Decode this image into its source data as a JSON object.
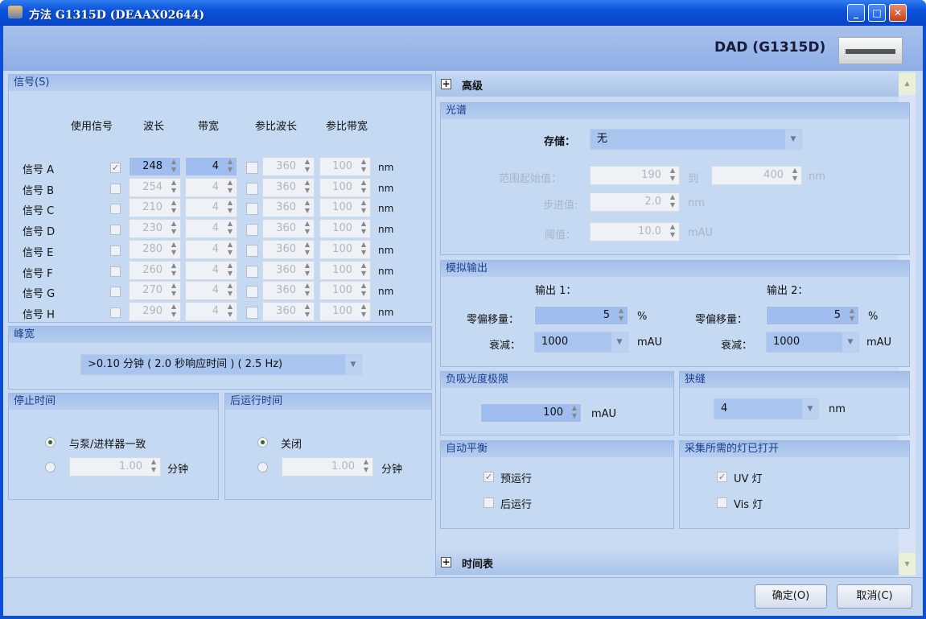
{
  "window": {
    "title": "方法 G1315D (DEAAX02644)",
    "minimize": "_",
    "maximize": "□",
    "close": "✕"
  },
  "header": {
    "device": "DAD (G1315D)"
  },
  "signals": {
    "title": "信号(S)",
    "columns": [
      "使用信号",
      "波长",
      "带宽",
      "参比波长",
      "参比带宽"
    ],
    "unit": "nm",
    "rows": [
      {
        "label": "信号 A",
        "use": true,
        "wl": "248",
        "bw": "4",
        "ref": false,
        "ref_wl": "360",
        "ref_bw": "100"
      },
      {
        "label": "信号 B",
        "use": false,
        "wl": "254",
        "bw": "4",
        "ref": false,
        "ref_wl": "360",
        "ref_bw": "100"
      },
      {
        "label": "信号 C",
        "use": false,
        "wl": "210",
        "bw": "4",
        "ref": false,
        "ref_wl": "360",
        "ref_bw": "100"
      },
      {
        "label": "信号 D",
        "use": false,
        "wl": "230",
        "bw": "4",
        "ref": false,
        "ref_wl": "360",
        "ref_bw": "100"
      },
      {
        "label": "信号 E",
        "use": false,
        "wl": "280",
        "bw": "4",
        "ref": false,
        "ref_wl": "360",
        "ref_bw": "100"
      },
      {
        "label": "信号 F",
        "use": false,
        "wl": "260",
        "bw": "4",
        "ref": false,
        "ref_wl": "360",
        "ref_bw": "100"
      },
      {
        "label": "信号 G",
        "use": false,
        "wl": "270",
        "bw": "4",
        "ref": false,
        "ref_wl": "360",
        "ref_bw": "100"
      },
      {
        "label": "信号 H",
        "use": false,
        "wl": "290",
        "bw": "4",
        "ref": false,
        "ref_wl": "360",
        "ref_bw": "100"
      }
    ]
  },
  "peakwidth": {
    "title": "峰宽",
    "value": ">0.10 分钟 ( 2.0 秒响应时间 ) ( 2.5 Hz)"
  },
  "stoptime": {
    "title": "停止时间",
    "opt1": "与泵/进样器一致",
    "value": "1.00",
    "unit": "分钟"
  },
  "posttime": {
    "title": "后运行时间",
    "opt1": "关闭",
    "value": "1.00",
    "unit": "分钟"
  },
  "advanced": {
    "title": "高级"
  },
  "spectrum": {
    "title": "光谱",
    "store_label": "存储：",
    "store_value": "无",
    "range_label": "范围起始值：",
    "range_from": "190",
    "to": "到",
    "range_to": "400",
    "nm": "nm",
    "step_label": "步进值:",
    "step": "2.0",
    "threshold_label": "阈值：",
    "threshold": "10.0",
    "mau": "mAU"
  },
  "analog": {
    "title": "模拟输出",
    "out1": "输出 1：",
    "out2": "输出 2：",
    "zero_label": "零偏移量：",
    "zero1": "5",
    "zero2": "5",
    "pct": "%",
    "atten_label": "衰减：",
    "atten1": "1000",
    "atten2": "1000",
    "mau": "mAU"
  },
  "negabs": {
    "title": "负吸光度极限",
    "value": "100",
    "unit": "mAU"
  },
  "slit": {
    "title": "狭缝",
    "value": "4",
    "unit": "nm"
  },
  "autobal": {
    "title": "自动平衡",
    "pre": "预运行",
    "pre_checked": true,
    "post": "后运行",
    "post_checked": false
  },
  "lamps": {
    "title": "采集所需的灯已打开",
    "uv": "UV 灯",
    "uv_checked": true,
    "vis": "Vis 灯",
    "vis_checked": false
  },
  "timetable": {
    "title": "时间表"
  },
  "buttons": {
    "ok": "确定(O)",
    "cancel": "取消(C)"
  }
}
